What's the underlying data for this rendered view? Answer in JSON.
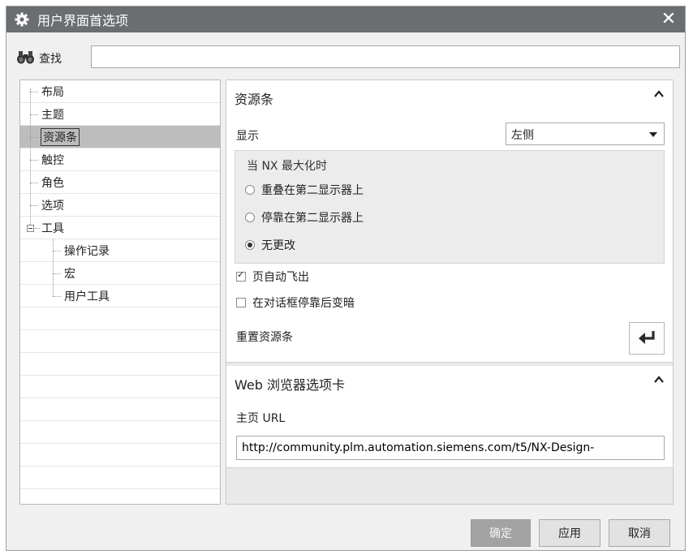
{
  "window": {
    "title": "用户界面首选项",
    "close_glyph": "✕"
  },
  "search": {
    "label": "查找",
    "value": "",
    "placeholder": ""
  },
  "tree": {
    "items": [
      {
        "label": "布局",
        "level": 1
      },
      {
        "label": "主题",
        "level": 1
      },
      {
        "label": "资源条",
        "level": 1,
        "selected": true
      },
      {
        "label": "触控",
        "level": 1
      },
      {
        "label": "角色",
        "level": 1
      },
      {
        "label": "选项",
        "level": 1
      },
      {
        "label": "工具",
        "level": 1,
        "expanded": true
      },
      {
        "label": "操作记录",
        "level": 2
      },
      {
        "label": "宏",
        "level": 2
      },
      {
        "label": "用户工具",
        "level": 2
      }
    ]
  },
  "resource_bar": {
    "title": "资源条",
    "display_label": "显示",
    "display_value": "左侧",
    "maximized_group": {
      "title": "当 NX 最大化时",
      "options": [
        "重叠在第二显示器上",
        "停靠在第二显示器上",
        "无更改"
      ],
      "selected_index": 2
    },
    "auto_flyout_label": "页自动飞出",
    "auto_flyout_checked": true,
    "dim_label": "在对话框停靠后变暗",
    "dim_checked": false,
    "reset_label": "重置资源条"
  },
  "web": {
    "title": "Web 浏览器选项卡",
    "home_url_label": "主页 URL",
    "home_url_value": "http://community.plm.automation.siemens.com/t5/NX-Design-"
  },
  "buttons": {
    "ok": "确定",
    "apply": "应用",
    "cancel": "取消"
  },
  "colors": {
    "titlebar": "#6b6e71",
    "selected_row": "#bdbdbd",
    "primary_button": "#a3a3a3"
  }
}
